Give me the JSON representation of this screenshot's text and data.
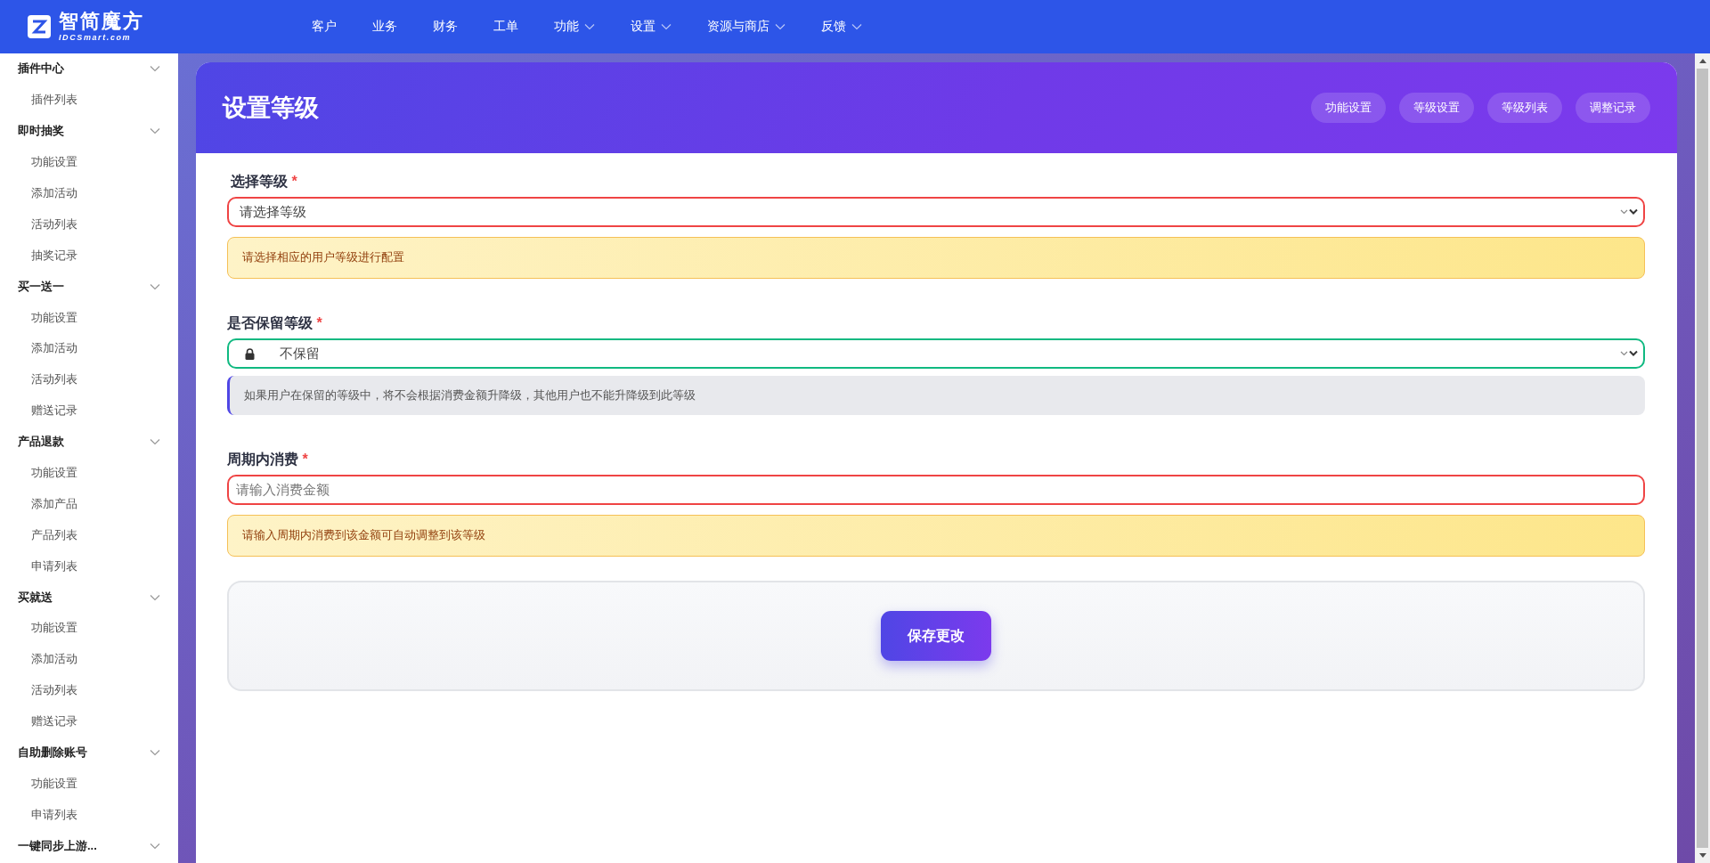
{
  "logo": {
    "name": "智简魔方",
    "tagline": "IDCSmart.com"
  },
  "nav": [
    {
      "label": "客户",
      "has_menu": false
    },
    {
      "label": "业务",
      "has_menu": false
    },
    {
      "label": "财务",
      "has_menu": false
    },
    {
      "label": "工单",
      "has_menu": false
    },
    {
      "label": "功能",
      "has_menu": true
    },
    {
      "label": "设置",
      "has_menu": true
    },
    {
      "label": "资源与商店",
      "has_menu": true
    },
    {
      "label": "反馈",
      "has_menu": true
    }
  ],
  "sidebar": [
    {
      "label": "插件中心",
      "expanded": true,
      "children": [
        {
          "label": "插件列表"
        }
      ]
    },
    {
      "label": "即时抽奖",
      "expanded": true,
      "children": [
        {
          "label": "功能设置"
        },
        {
          "label": "添加活动"
        },
        {
          "label": "活动列表"
        },
        {
          "label": "抽奖记录"
        }
      ]
    },
    {
      "label": "买一送一",
      "expanded": true,
      "children": [
        {
          "label": "功能设置"
        },
        {
          "label": "添加活动"
        },
        {
          "label": "活动列表"
        },
        {
          "label": "赠送记录"
        }
      ]
    },
    {
      "label": "产品退款",
      "expanded": true,
      "children": [
        {
          "label": "功能设置"
        },
        {
          "label": "添加产品"
        },
        {
          "label": "产品列表"
        },
        {
          "label": "申请列表"
        }
      ]
    },
    {
      "label": "买就送",
      "expanded": true,
      "children": [
        {
          "label": "功能设置"
        },
        {
          "label": "添加活动"
        },
        {
          "label": "活动列表"
        },
        {
          "label": "赠送记录"
        }
      ]
    },
    {
      "label": "自助删除账号",
      "expanded": true,
      "children": [
        {
          "label": "功能设置"
        },
        {
          "label": "申请列表"
        }
      ]
    },
    {
      "label": "一键同步上游...",
      "expanded": true
    }
  ],
  "page": {
    "title": "设置等级",
    "header_buttons": [
      "功能设置",
      "等级设置",
      "等级列表",
      "调整记录"
    ]
  },
  "fields": [
    {
      "kind": "select",
      "label": "选择等级",
      "required_mark": "*",
      "value": "请选择等级",
      "locked": false,
      "invalid": true,
      "hint": {
        "kind": "warning",
        "text": "请选择相应的用户等级进行配置"
      }
    },
    {
      "kind": "select",
      "label": "是否保留等级",
      "required_mark": "*",
      "value": "不保留",
      "locked": true,
      "invalid": false,
      "hint": {
        "kind": "info",
        "text": "如果用户在保留的等级中，将不会根据消费金额升降级，其他用户也不能升降级到此等级"
      }
    },
    {
      "kind": "input",
      "label": "周期内消费",
      "required_mark": "*",
      "placeholder": "请输入消费金额",
      "invalid": true,
      "hint": {
        "kind": "warning",
        "text": "请输入周期内消费到该金额可自动调整到该等级"
      }
    }
  ],
  "save_button": "保存更改"
}
